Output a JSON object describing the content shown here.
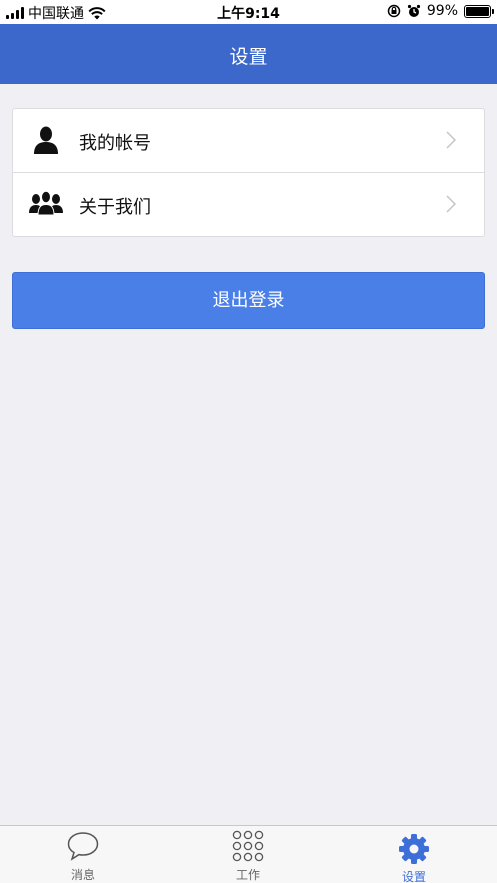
{
  "status_bar": {
    "carrier": "中国联通",
    "time": "上午9:14",
    "battery": "99%"
  },
  "header": {
    "title": "设置"
  },
  "settings_list": {
    "items": [
      {
        "label": "我的帐号",
        "icon": "person-icon"
      },
      {
        "label": "关于我们",
        "icon": "group-icon"
      }
    ]
  },
  "logout": {
    "label": "退出登录"
  },
  "tab_bar": {
    "tabs": [
      {
        "label": "消息",
        "icon": "chat-bubble-icon"
      },
      {
        "label": "工作",
        "icon": "grid-icon"
      },
      {
        "label": "设置",
        "icon": "gear-icon"
      }
    ],
    "active_index": 2
  },
  "colors": {
    "nav_bar": "#3d68cb",
    "primary_button": "#4a7fe8",
    "active_tab": "#3d6fd8",
    "background": "#efeff4"
  }
}
